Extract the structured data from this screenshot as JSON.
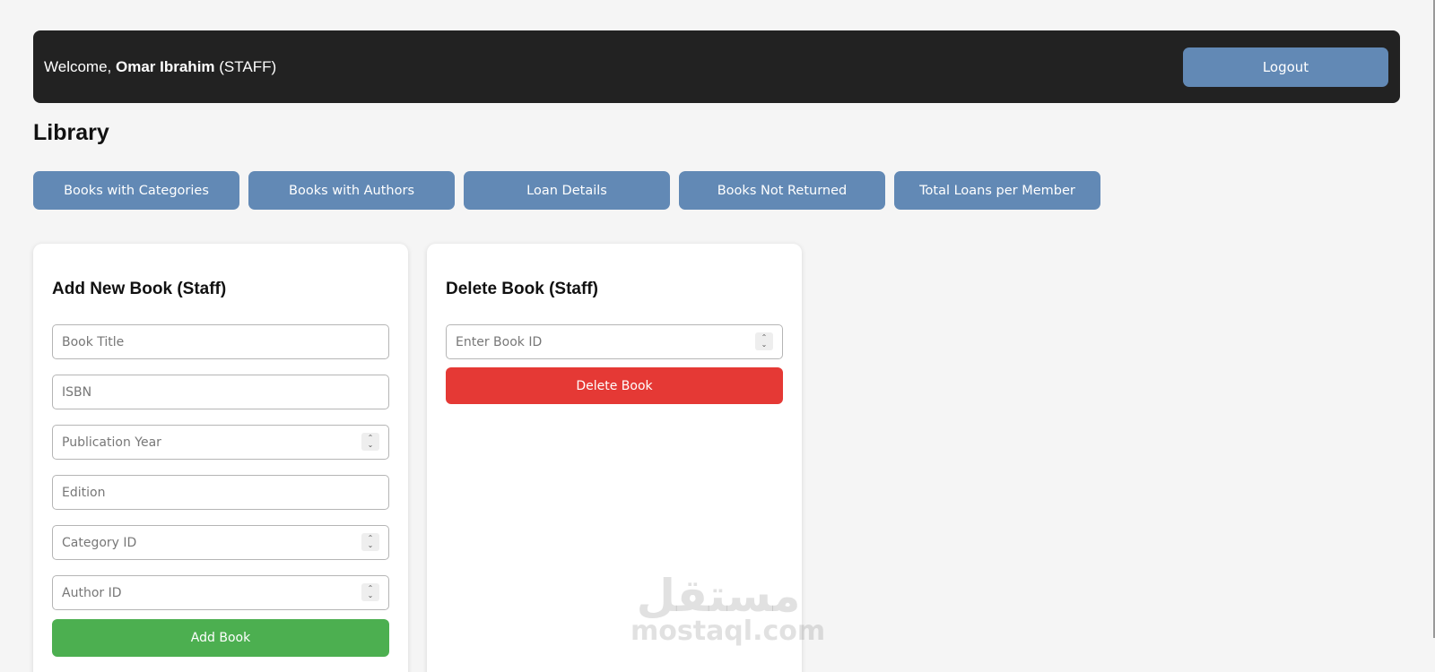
{
  "header": {
    "welcome_prefix": "Welcome, ",
    "user_name": "Omar Ibrahim",
    "user_role": " (STAFF)",
    "logout_label": "Logout"
  },
  "page_title": "Library",
  "nav": {
    "items": [
      {
        "label": "Books with Categories"
      },
      {
        "label": "Books with Authors"
      },
      {
        "label": "Loan Details"
      },
      {
        "label": "Books Not Returned"
      },
      {
        "label": "Total Loans per Member"
      }
    ]
  },
  "add_book": {
    "title": "Add New Book (Staff)",
    "fields": [
      {
        "placeholder": "Book Title",
        "value": ""
      },
      {
        "placeholder": "ISBN",
        "value": ""
      },
      {
        "placeholder": "Publication Year",
        "value": ""
      },
      {
        "placeholder": "Edition",
        "value": ""
      },
      {
        "placeholder": "Category ID",
        "value": ""
      },
      {
        "placeholder": "Author ID",
        "value": ""
      }
    ],
    "submit_label": "Add Book"
  },
  "delete_book": {
    "title": "Delete Book (Staff)",
    "field": {
      "placeholder": "Enter Book ID",
      "value": ""
    },
    "submit_label": "Delete Book"
  },
  "watermark": {
    "arabic": "مستقل",
    "latin": "mostaql.com"
  },
  "colors": {
    "header_bg": "#222222",
    "primary_button": "#6289b5",
    "add_button": "#4caf50",
    "delete_button": "#e53935",
    "page_bg": "#f5f5f5"
  },
  "icons": {
    "stepper": "up-down-chevron-icon"
  }
}
